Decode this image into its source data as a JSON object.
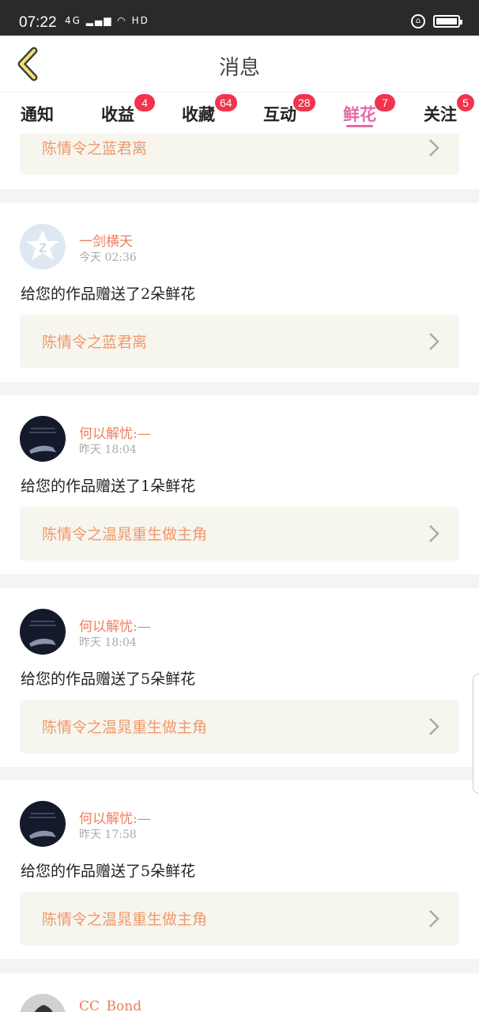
{
  "status_bar": {
    "time": "07:22",
    "network": "4G",
    "hd": "HD"
  },
  "header": {
    "title": "消息"
  },
  "tabs": [
    {
      "label": "通知",
      "badge": ""
    },
    {
      "label": "收益",
      "badge": "4"
    },
    {
      "label": "收藏",
      "badge": "64"
    },
    {
      "label": "互动",
      "badge": "28"
    },
    {
      "label": "鲜花",
      "badge": "7"
    },
    {
      "label": "关注",
      "badge": "5"
    }
  ],
  "active_tab": "鲜花",
  "colors": {
    "accent": "#e46aa6",
    "badge": "#f2334d",
    "username": "#ee7e5a",
    "work_title": "#f0996a"
  },
  "feed": {
    "partial_top": {
      "work_title": "陈情令之蓝君离"
    },
    "items": [
      {
        "username": "一剑横天",
        "time": "今天 02:36",
        "message": "给您的作品赠送了2朵鲜花",
        "work_title": "陈情令之蓝君离",
        "avatar": "default-avatar"
      },
      {
        "username": "何以解忧:—",
        "time": "昨天 18:04",
        "message": "给您的作品赠送了1朵鲜花",
        "work_title": "陈情令之温晁重生做主角",
        "avatar": "dark-avatar"
      },
      {
        "username": "何以解忧:—",
        "time": "昨天 18:04",
        "message": "给您的作品赠送了5朵鲜花",
        "work_title": "陈情令之温晁重生做主角",
        "avatar": "dark-avatar"
      },
      {
        "username": "何以解忧:—",
        "time": "昨天 17:58",
        "message": "给您的作品赠送了5朵鲜花",
        "work_title": "陈情令之温晁重生做主角",
        "avatar": "dark-avatar"
      }
    ],
    "partial_bottom": {
      "username": "CC_Bond"
    }
  }
}
